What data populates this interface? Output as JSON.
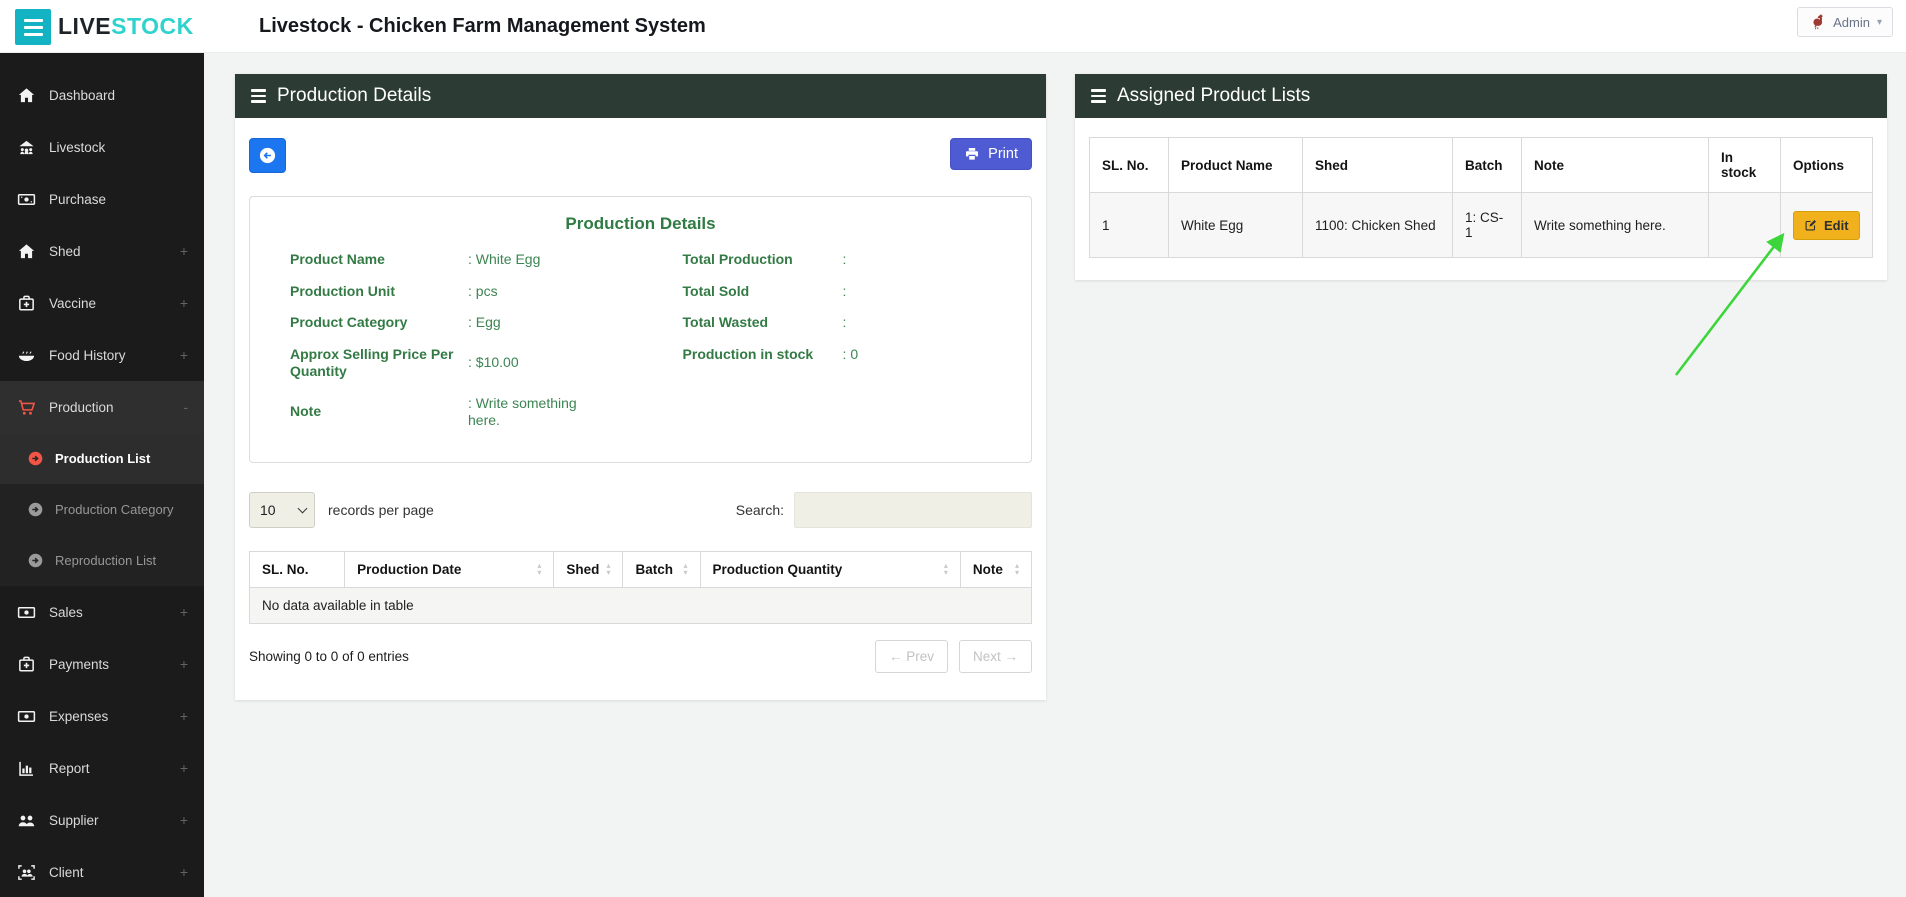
{
  "colors": {
    "brand_teal": "#14b3c3",
    "brand_stock_text": "#2ed3cd",
    "sidebar_bg": "#1b1b1b",
    "panel_header_bg": "#2c3b34",
    "green_text": "#337a45",
    "active_red": "#f05546",
    "back_button_blue": "#1b76f0",
    "print_button_indigo": "#4e5bd2",
    "edit_button_amber": "#f0b11d",
    "annotation_arrow_green": "#3cd63c",
    "page_bg": "#f2f4f3"
  },
  "icons": {
    "menu-icon": "three-bars",
    "panel-menu-icon": "three-bars",
    "caret-down-icon": "▾",
    "sort-icon": "▴▾",
    "back-icon": "arrow-circle-left",
    "print-icon": "printer",
    "edit-icon": "pencil-square",
    "admin-avatar-icon": "rooster",
    "prev-arrow": "←",
    "next-arrow": "→"
  },
  "topbar": {
    "brand_live": "LIVE",
    "brand_stock": "STOCK",
    "title": "Livestock - Chicken Farm Management System",
    "admin_label": "Admin"
  },
  "sidebar": {
    "items": [
      {
        "label": "Dashboard",
        "icon": "home-icon"
      },
      {
        "label": "Livestock",
        "icon": "livestock-icon"
      },
      {
        "label": "Purchase",
        "icon": "money-icon"
      },
      {
        "label": "Shed",
        "icon": "home-icon",
        "expand": "+"
      },
      {
        "label": "Vaccine",
        "icon": "medkit-icon",
        "expand": "+"
      },
      {
        "label": "Food History",
        "icon": "food-icon",
        "expand": "+"
      },
      {
        "label": "Production",
        "icon": "cart-icon",
        "expand": "-",
        "active": true
      },
      {
        "label": "Sales",
        "icon": "money-icon",
        "expand": "+"
      },
      {
        "label": "Payments",
        "icon": "medkit-icon",
        "expand": "+"
      },
      {
        "label": "Expenses",
        "icon": "money-icon",
        "expand": "+"
      },
      {
        "label": "Report",
        "icon": "chart-icon",
        "expand": "+"
      },
      {
        "label": "Supplier",
        "icon": "users-icon",
        "expand": "+"
      },
      {
        "label": "Client",
        "icon": "client-icon",
        "expand": "+"
      }
    ],
    "submenu": [
      {
        "label": "Production List",
        "active": true
      },
      {
        "label": "Production Category"
      },
      {
        "label": "Reproduction List"
      }
    ]
  },
  "production_panel": {
    "title": "Production Details",
    "print_label": "Print",
    "details": {
      "title": "Production Details",
      "left": [
        {
          "label": "Product Name",
          "value": ": White Egg"
        },
        {
          "label": "Production Unit",
          "value": ": pcs"
        },
        {
          "label": "Product Category",
          "value": ": Egg"
        },
        {
          "label": "Approx Selling Price Per Quantity",
          "value": ": $10.00"
        },
        {
          "label": "Note",
          "value": ": Write something here."
        }
      ],
      "right": [
        {
          "label": "Total Production",
          "value": ":"
        },
        {
          "label": "Total Sold",
          "value": ":"
        },
        {
          "label": "Total Wasted",
          "value": ":"
        },
        {
          "label": "Production in stock",
          "value": ": 0"
        }
      ]
    },
    "controls": {
      "page_size": "10",
      "records_label": "records per page",
      "search_label": "Search:",
      "search_value": ""
    },
    "table": {
      "columns": [
        "SL. No.",
        "Production Date",
        "Shed",
        "Batch",
        "Production Quantity",
        "Note"
      ],
      "empty_message": "No data available in table"
    },
    "pagination": {
      "info": "Showing 0 to 0 of 0 entries",
      "prev_label": "← Prev",
      "next_label": "Next →"
    }
  },
  "assigned_panel": {
    "title": "Assigned Product Lists",
    "columns": [
      "SL. No.",
      "Product Name",
      "Shed",
      "Batch",
      "Note",
      "In stock",
      "Options"
    ],
    "rows": [
      {
        "sl_no": "1",
        "product_name": "White Egg",
        "shed": "1100: Chicken Shed",
        "batch": "1: CS-1",
        "note": "Write something here.",
        "in_stock": "",
        "edit_label": "Edit"
      }
    ]
  }
}
